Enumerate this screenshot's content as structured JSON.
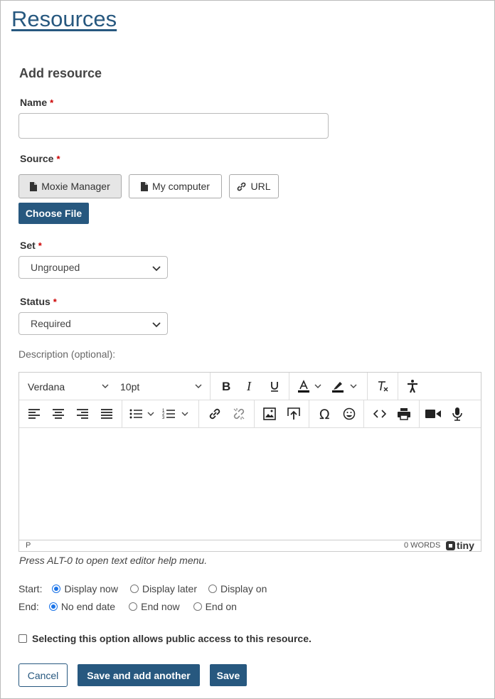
{
  "page_title": "Resources",
  "form_heading": "Add resource",
  "name": {
    "label": "Name",
    "required_mark": "*",
    "value": ""
  },
  "source": {
    "label": "Source",
    "required_mark": "*",
    "options": [
      "Moxie Manager",
      "My computer",
      "URL"
    ],
    "active": "Moxie Manager",
    "choose_file": "Choose File"
  },
  "set": {
    "label": "Set",
    "required_mark": "*",
    "selected": "Ungrouped"
  },
  "status": {
    "label": "Status",
    "required_mark": "*",
    "selected": "Required"
  },
  "description": {
    "label": "Description (optional):",
    "font_family": "Verdana",
    "font_size": "10pt",
    "status_path": "P",
    "word_count": "0 WORDS",
    "brand": "tiny",
    "help_text": "Press ALT-0 to open text editor help menu."
  },
  "start": {
    "label": "Start:",
    "options": [
      "Display now",
      "Display later",
      "Display on"
    ],
    "selected": "Display now"
  },
  "end": {
    "label": "End:",
    "options": [
      "No end date",
      "End now",
      "End on"
    ],
    "selected": "No end date"
  },
  "public_access": {
    "label": "Selecting this option allows public access to this resource.",
    "checked": false
  },
  "actions": {
    "cancel": "Cancel",
    "save_add": "Save and add another",
    "save": "Save"
  },
  "colors": {
    "brand": "#27587f",
    "radio_selected": "#1a73e8",
    "required": "#cc0000"
  },
  "toolbar_icons": {
    "row1": [
      "bold-icon",
      "italic-icon",
      "underline-icon",
      "text-color-icon",
      "highlight-icon",
      "clear-format-icon",
      "accessibility-icon"
    ],
    "row2": [
      "align-left-icon",
      "align-center-icon",
      "align-right-icon",
      "justify-icon",
      "bullet-list-icon",
      "numbered-list-icon",
      "link-icon",
      "unlink-icon",
      "image-icon",
      "upload-icon",
      "omega-icon",
      "emoji-icon",
      "code-icon",
      "print-icon",
      "video-icon",
      "microphone-icon"
    ]
  }
}
